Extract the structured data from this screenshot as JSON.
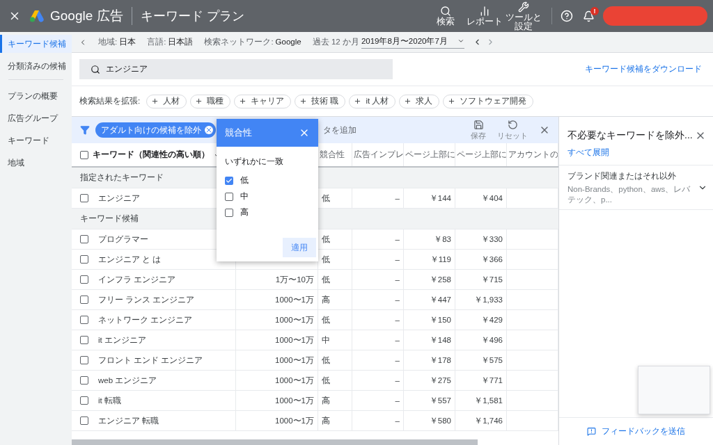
{
  "header": {
    "product": "Google 広告",
    "page_title": "キーワード プラン",
    "tools": [
      {
        "kind": "search",
        "label": "検索"
      },
      {
        "kind": "report",
        "label": "レポート"
      },
      {
        "kind": "tools",
        "label": "ツールと設定"
      }
    ],
    "notification_badge": "!"
  },
  "sidebar": {
    "items": [
      {
        "label": "キーワード候補",
        "selected": true
      },
      {
        "label": "分類済みの候補",
        "selected": false
      },
      {
        "label": "プランの概要",
        "selected": false
      },
      {
        "label": "広告グループ",
        "selected": false
      },
      {
        "label": "キーワード",
        "selected": false
      },
      {
        "label": "地域",
        "selected": false
      }
    ]
  },
  "settings_bar": [
    {
      "label": "地域:",
      "value": "日本"
    },
    {
      "label": "言語:",
      "value": "日本語"
    },
    {
      "label": "検索ネットワーク:",
      "value": "Google"
    },
    {
      "label": "過去 12 か月",
      "value": "2019年8月〜2020年7月"
    }
  ],
  "search": {
    "value": "エンジニア",
    "download_link": "キーワード候補をダウンロード"
  },
  "expand": {
    "label": "検索結果を拡張:",
    "chips": [
      "人材",
      "職種",
      "キャリア",
      "技術 職",
      "it 人材",
      "求人",
      "ソフトウェア開発"
    ]
  },
  "filter_bar": {
    "chip": "アダルト向けの候補を除外",
    "add_filter": "タを追加",
    "save": "保存",
    "reset": "リセット"
  },
  "table": {
    "all_checked": false,
    "columns": [
      {
        "label": "キーワード（関連性の高い順）",
        "sorted": true
      },
      {
        "label": "競合性",
        "sorted": false
      },
      {
        "label": "広告インプレ",
        "sorted": false
      },
      {
        "label": "ページ上部に",
        "sorted": false
      },
      {
        "label": "ページ上部に",
        "sorted": false
      },
      {
        "label": "アカウントの",
        "sorted": false
      }
    ],
    "sections": [
      {
        "title": "指定されたキーワード",
        "rows": [
          {
            "keyword": "エンジニア",
            "competition": "低",
            "impressions": "–",
            "bid_low": "￥144",
            "bid_high": "￥404",
            "checked": false
          }
        ]
      },
      {
        "title": "キーワード候補",
        "rows": [
          {
            "keyword": "プログラマー",
            "competition": "低",
            "impressions": "–",
            "bid_low": "￥83",
            "bid_high": "￥330",
            "checked": false
          },
          {
            "keyword": "エンジニア と は",
            "competition": "低",
            "impressions": "–",
            "bid_low": "￥119",
            "bid_high": "￥366",
            "checked": false
          },
          {
            "keyword": "インフラ エンジニア",
            "searches": "1万〜10万",
            "competition": "低",
            "impressions": "–",
            "bid_low": "￥258",
            "bid_high": "￥715",
            "checked": false
          },
          {
            "keyword": "フリー ランス エンジニア",
            "searches": "1000〜1万",
            "competition": "高",
            "impressions": "–",
            "bid_low": "￥447",
            "bid_high": "￥1,933",
            "checked": false
          },
          {
            "keyword": "ネットワーク エンジニア",
            "searches": "1000〜1万",
            "competition": "低",
            "impressions": "–",
            "bid_low": "￥150",
            "bid_high": "￥429",
            "checked": false
          },
          {
            "keyword": "it エンジニア",
            "searches": "1000〜1万",
            "competition": "中",
            "impressions": "–",
            "bid_low": "￥148",
            "bid_high": "￥496",
            "checked": false
          },
          {
            "keyword": "フロント エンド エンジニア",
            "searches": "1000〜1万",
            "competition": "低",
            "impressions": "–",
            "bid_low": "￥178",
            "bid_high": "￥575",
            "checked": false
          },
          {
            "keyword": "web エンジニア",
            "searches": "1000〜1万",
            "competition": "低",
            "impressions": "–",
            "bid_low": "￥275",
            "bid_high": "￥771",
            "checked": false
          },
          {
            "keyword": "it 転職",
            "searches": "1000〜1万",
            "competition": "高",
            "impressions": "–",
            "bid_low": "￥557",
            "bid_high": "￥1,581",
            "checked": false
          },
          {
            "keyword": "エンジニア 転職",
            "searches": "1000〜1万",
            "competition": "高",
            "impressions": "–",
            "bid_low": "￥580",
            "bid_high": "￥1,746",
            "checked": false
          }
        ]
      }
    ]
  },
  "filter_popup": {
    "title": "競合性",
    "subtitle": "いずれかに一致",
    "options": [
      {
        "label": "低",
        "checked": true
      },
      {
        "label": "中",
        "checked": false
      },
      {
        "label": "高",
        "checked": false
      }
    ],
    "apply": "適用"
  },
  "right_panel": {
    "title": "不必要なキーワードを除外...",
    "expand_all": "すべて展開",
    "groups": [
      {
        "title": "ブランド関連またはそれ以外",
        "summary": "Non-Brands、python、aws、レバテック、p...",
        "expanded": false
      }
    ],
    "feedback": "フィードバックを送信"
  }
}
